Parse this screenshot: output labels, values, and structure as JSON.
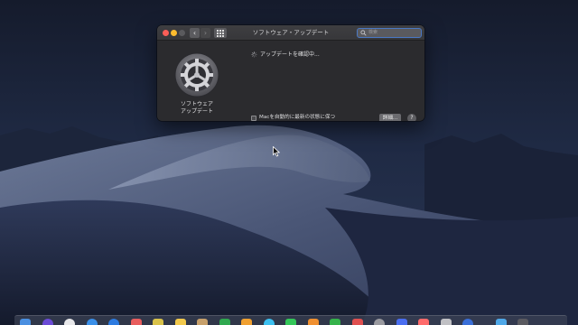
{
  "window": {
    "title": "ソフトウェア・アップデート",
    "search_placeholder": "検索",
    "app_label_line1": "ソフトウェア",
    "app_label_line2": "アップデート",
    "status_text": "アップデートを確認中...",
    "checkbox_label": "Macを自動的に最新の状態に保つ",
    "checkbox_checked": false,
    "details_button": "詳細...",
    "help_button": "?",
    "back_arrow": "‹",
    "forward_arrow": "›"
  },
  "colors": {
    "close": "#fc5e57",
    "minimize": "#fdbc2e",
    "search_focus": "#4a78c4",
    "window_bg": "#2b2b2e"
  },
  "icons": {
    "app": "gear-icon",
    "search": "search-icon",
    "status": "spinner-icon"
  },
  "dock": {
    "icon_colors": [
      "#4a8fe0",
      "#6b4bd6",
      "#e8e8ea",
      "#3a8fe8",
      "#2d7be0",
      "#e85d5d",
      "#d9c24a",
      "#f2c94c",
      "#c7a06b",
      "#2fa84f",
      "#f0a030",
      "#3cc0f0",
      "#34c759",
      "#f09030",
      "#35b24a",
      "#e05050",
      "#9a9aa0",
      "#4a6ef0",
      "#ff6b6b",
      "#c0c0c4",
      "#3a6fd8",
      "#4fa8e8",
      "#5a5a60"
    ]
  }
}
